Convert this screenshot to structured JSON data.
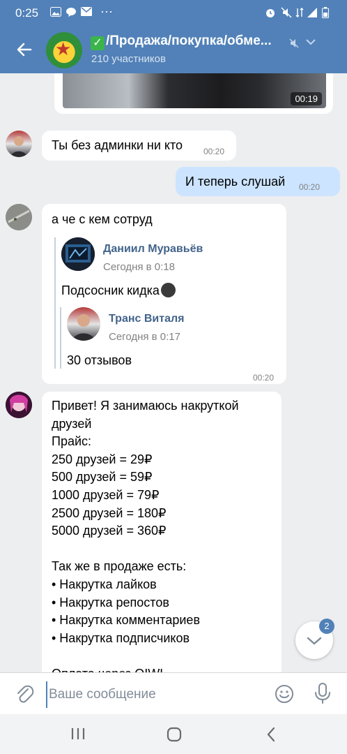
{
  "status_bar": {
    "time": "0:25",
    "icons": [
      "image-icon",
      "message-icon",
      "mail-icon",
      "more-icon",
      "alarm-icon",
      "mute-icon",
      "data-icon",
      "signal-icon",
      "battery-icon"
    ],
    "more": "···"
  },
  "header": {
    "title": "/Продажа/покупка/обме...",
    "members": "210 участников"
  },
  "video": {
    "duration": "00:19"
  },
  "messages": {
    "m1": {
      "text": "Ты без админки ни кто",
      "time": "00:20"
    },
    "m2": {
      "text": "И теперь слушай",
      "time": "00:20"
    },
    "m3": {
      "text": "а че с кем сотруд",
      "time": "00:20",
      "forward": {
        "name": "Даниил Муравьёв",
        "date": "Сегодня в 0:18",
        "text": "Подсосник кидка",
        "nested": {
          "name": "Транс Виталя",
          "date": "Сегодня в 0:17",
          "text": "30 отзывов"
        }
      }
    },
    "m4": {
      "text": "Привет! Я занимаюсь накруткой\nдрузей\nПрайс:\n250 друзей = 29₽\n500 друзей = 59₽\n1000 друзей = 79₽\n2500 друзей = 180₽\n5000 друзей = 360₽\n\nТак же в продаже есть:\n• Накрутка лайков\n• Накрутка репостов\n• Накрутка комментариев\n• Накрутка подписчиков\n\nОплата через QIWI"
    }
  },
  "scroll_button": {
    "badge": "2"
  },
  "composer": {
    "placeholder": "Ваше сообщение"
  },
  "colors": {
    "brand": "#5181b8",
    "outgoing": "#cce4ff",
    "link": "#42648b"
  }
}
